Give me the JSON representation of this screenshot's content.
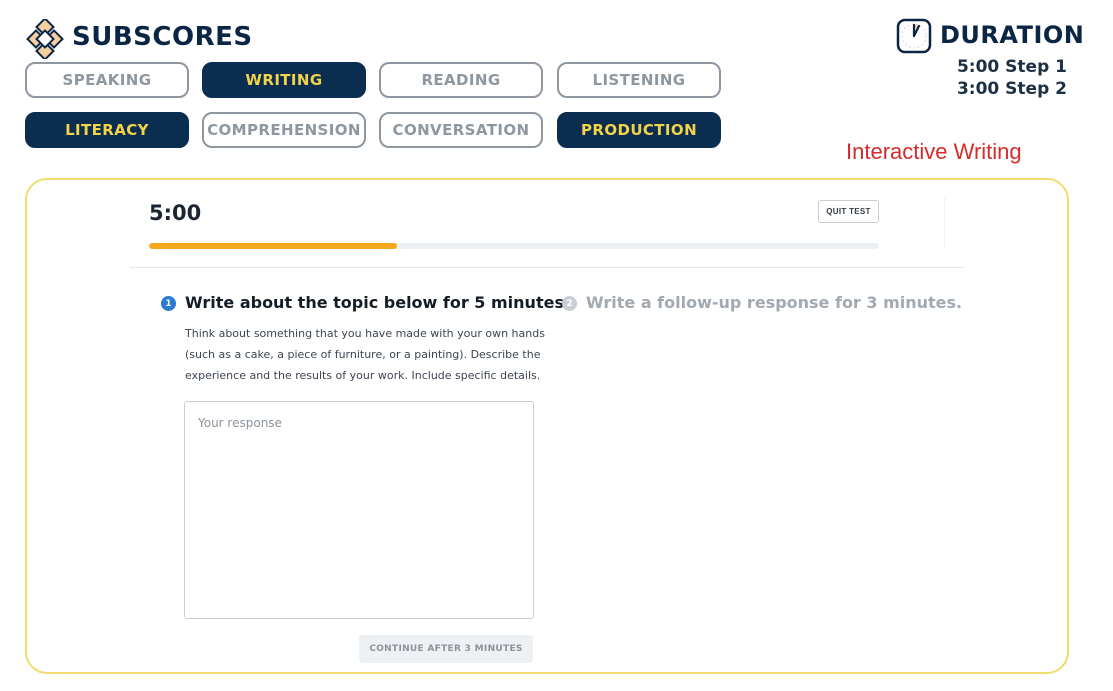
{
  "header": {
    "title": "SUBSCORES",
    "logo_icon": "diamond-lattice-icon"
  },
  "subscores_row1": [
    {
      "label": "SPEAKING",
      "active": false
    },
    {
      "label": "WRITING",
      "active": true
    },
    {
      "label": "READING",
      "active": false
    },
    {
      "label": "LISTENING",
      "active": false
    }
  ],
  "subscores_row2": [
    {
      "label": "LITERACY",
      "active": true
    },
    {
      "label": "COMPREHENSION",
      "active": false
    },
    {
      "label": "CONVERSATION",
      "active": false
    },
    {
      "label": "PRODUCTION",
      "active": true
    }
  ],
  "duration": {
    "title": "DURATION",
    "icon": "clock-icon",
    "step1": "5:00 Step 1",
    "step2": "3:00 Step 2"
  },
  "task_label": "Interactive Writing",
  "test": {
    "timer": "5:00",
    "quit_label": "QUIT TEST",
    "progress_fraction": 0.34,
    "step1_number": "1",
    "step1_heading": "Write about the topic below for 5 minutes.",
    "step2_number": "2",
    "step2_heading": "Write a follow-up response for 3 minutes.",
    "prompt_line1": "Think about something that you have made with your own hands",
    "prompt_line2": "(such as a cake, a piece of furniture, or a painting). Describe the",
    "prompt_line3": "experience and the results of your work. Include specific details.",
    "response_placeholder": "Your response",
    "continue_label": "CONTINUE AFTER 3 MINUTES"
  },
  "colors": {
    "navy": "#0b2d4f",
    "yellow_text": "#f3d34a",
    "frame_border": "#f0dd6e",
    "progress": "#f5a81c",
    "accent_red": "#d62b2b",
    "step_blue": "#2a7bd1"
  }
}
